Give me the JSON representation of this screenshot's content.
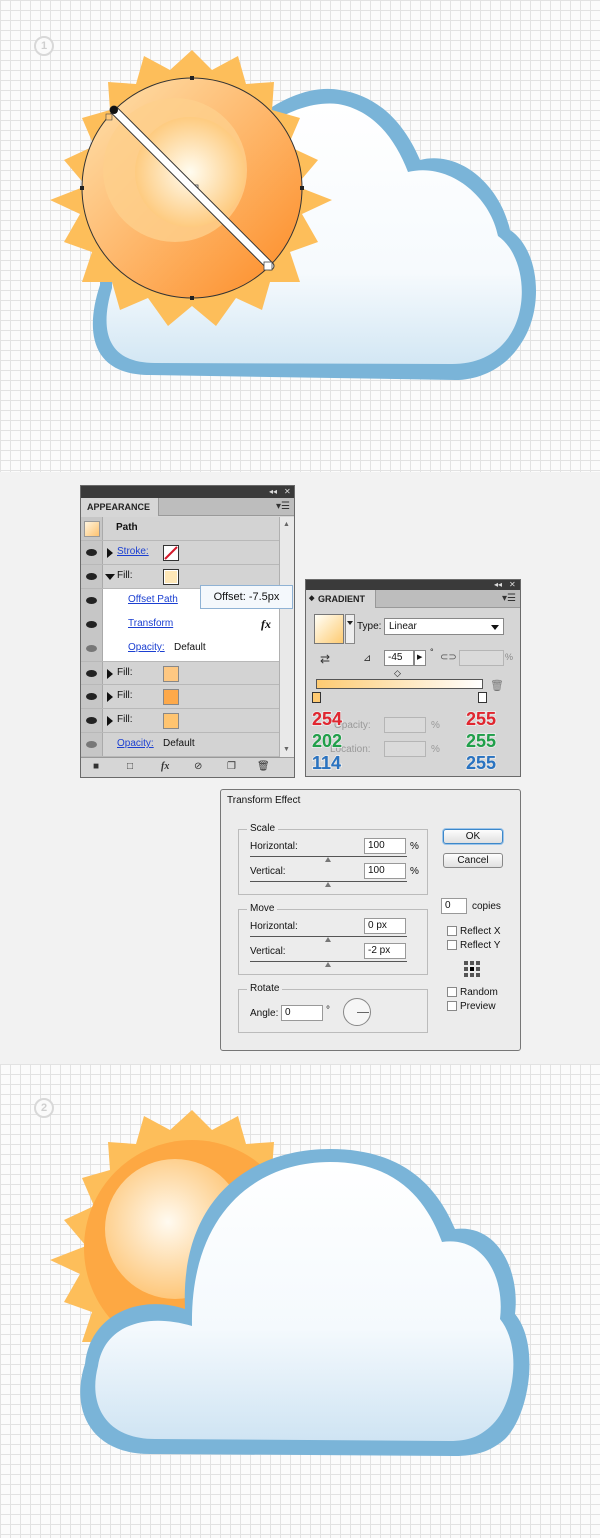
{
  "steps": {
    "first": "1",
    "second": "2"
  },
  "appearance_panel": {
    "title": "APPEARANCE",
    "path_label": "Path",
    "rows": [
      {
        "label": "Stroke:",
        "swatch": "none"
      },
      {
        "label": "Fill:",
        "swatch": "#fee7b7"
      },
      {
        "label": "Offset Path"
      },
      {
        "label": "Transform",
        "fx": "fx"
      },
      {
        "label": "Opacity:",
        "value": "Default"
      },
      {
        "label": "Fill:",
        "swatch": "#fec882"
      },
      {
        "label": "Fill:",
        "swatch": "#fda94a"
      },
      {
        "label": "Fill:",
        "swatch": "#fec470"
      },
      {
        "label": "Opacity:",
        "value": "Default"
      }
    ]
  },
  "tooltip": {
    "text": "Offset: -7.5px"
  },
  "gradient_panel": {
    "title": "GRADIENT",
    "type_label": "Type:",
    "type_value": "Linear",
    "angle": "-45",
    "opacity_label": "Opacity:",
    "location_label": "Location:",
    "percent": "%",
    "left_stop": {
      "r": "254",
      "g": "202",
      "b": "114",
      "color": "#feca72"
    },
    "right_stop": {
      "r": "255",
      "g": "255",
      "b": "255",
      "color": "#ffffff"
    }
  },
  "transform_dialog": {
    "title": "Transform Effect",
    "scale": {
      "label": "Scale",
      "horizontal_label": "Horizontal:",
      "horizontal": "100",
      "vertical_label": "Vertical:",
      "vertical": "100",
      "unit": "%"
    },
    "move": {
      "label": "Move",
      "horizontal_label": "Horizontal:",
      "horizontal": "0 px",
      "vertical_label": "Vertical:",
      "vertical": "-2 px"
    },
    "rotate": {
      "label": "Rotate",
      "angle_label": "Angle:",
      "angle": "0",
      "degree": "°"
    },
    "ok_label": "OK",
    "cancel_label": "Cancel",
    "copies_value": "0",
    "copies_label": "copies",
    "reflect_x": "Reflect X",
    "reflect_y": "Reflect Y",
    "random": "Random",
    "preview": "Preview"
  },
  "colors": {
    "sun_light": "#fee9b5",
    "sun_dark": "#fd8f2b",
    "ray": "#fdbe5a",
    "cloud_border": "#7ab4d8",
    "cloud_body": "#eef6fb",
    "red_digits": "#e2262f",
    "green_digits": "#20a04a",
    "blue_digits": "#2a74c2"
  }
}
